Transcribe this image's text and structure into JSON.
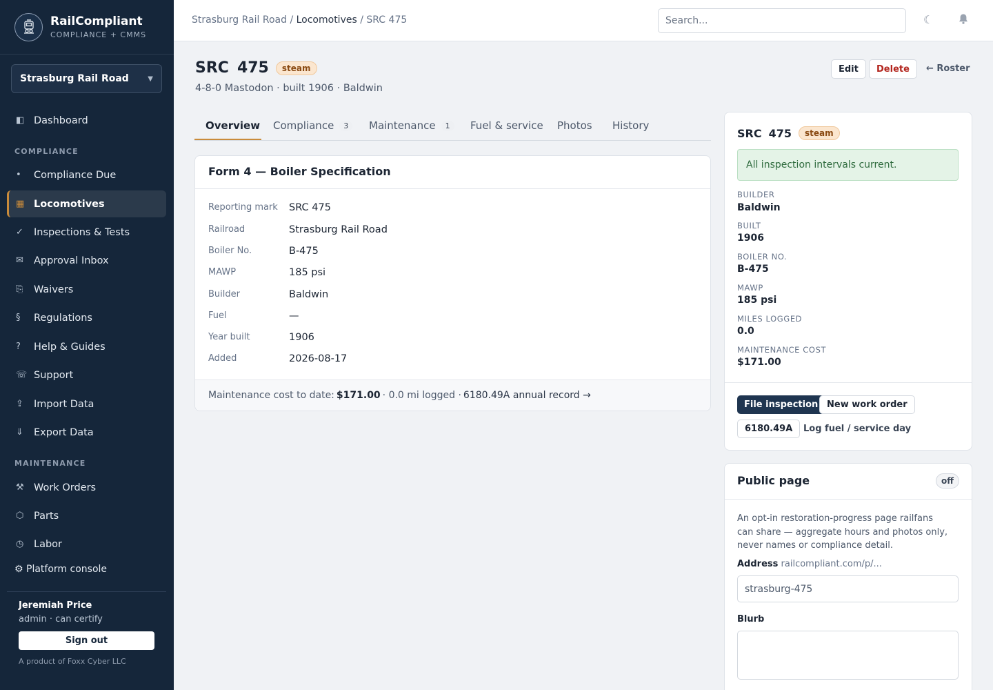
{
  "brand": {
    "name": "RailCompliant",
    "tagline": "COMPLIANCE + CMMS"
  },
  "railroad_select": {
    "value": "Strasburg Rail Road"
  },
  "nav": {
    "dashboard": "Dashboard",
    "compliance_section": "COMPLIANCE",
    "compliance_items": [
      "Compliance Due",
      "Locomotives",
      "Inspections & Tests",
      "Approval Inbox",
      "Waivers",
      "Regulations",
      "Help & Guides",
      "Support",
      "Import Data",
      "Export Data"
    ],
    "maintenance_section": "MAINTENANCE",
    "maintenance_items": [
      "Work Orders",
      "Parts",
      "Labor"
    ],
    "platform_console": "Platform console"
  },
  "user": {
    "name": "Jeremiah Price",
    "role": "admin · can certify",
    "signout_label": "Sign out",
    "product": "A product of Foxx Cyber LLC"
  },
  "topbar": {
    "breadcrumb": [
      "Strasburg Rail Road",
      "Locomotives",
      "SRC 475"
    ],
    "search_placeholder": "Search..."
  },
  "header": {
    "mark": "SRC",
    "number": "475",
    "tag": "steam",
    "subtitle": "4-8-0 Mastodon · built 1906 · Baldwin",
    "edit_label": "Edit",
    "delete_label": "Delete",
    "roster_label": "← Roster"
  },
  "tabs": [
    {
      "label": "Overview",
      "count": ""
    },
    {
      "label": "Compliance",
      "count": "3"
    },
    {
      "label": "Maintenance",
      "count": "1"
    },
    {
      "label": "Fuel & service",
      "count": ""
    },
    {
      "label": "Photos",
      "count": ""
    },
    {
      "label": "History",
      "count": ""
    }
  ],
  "form4": {
    "title": "Form 4 — Boiler Specification",
    "rows": [
      {
        "label": "Reporting mark",
        "value": "SRC 475"
      },
      {
        "label": "Railroad",
        "value": "Strasburg Rail Road"
      },
      {
        "label": "Boiler No.",
        "value": "B-475"
      },
      {
        "label": "MAWP",
        "value": "185 psi"
      },
      {
        "label": "Builder",
        "value": "Baldwin"
      },
      {
        "label": "Fuel",
        "value": "—"
      },
      {
        "label": "Year built",
        "value": "1906"
      },
      {
        "label": "Added",
        "value": "2026-08-17"
      }
    ],
    "footer": {
      "prefix": "Maintenance cost to date:",
      "cost": "$171.00",
      "middle": "· 0.0 mi logged ·",
      "link": "6180.49A annual record →"
    }
  },
  "summary": {
    "mark": "SRC",
    "number": "475",
    "tag": "steam",
    "alert": "All inspection intervals current.",
    "fields": [
      {
        "label": "BUILDER",
        "value": "Baldwin"
      },
      {
        "label": "BUILT",
        "value": "1906"
      },
      {
        "label": "BOILER NO.",
        "value": "B-475"
      },
      {
        "label": "MAWP",
        "value": "185 psi"
      },
      {
        "label": "MILES LOGGED",
        "value": "0.0"
      },
      {
        "label": "MAINTENANCE COST",
        "value": "$171.00"
      }
    ],
    "file_inspection": "File inspection",
    "new_work_order": "New work order",
    "form_6180": "6180.49A",
    "log_fuel": "Log fuel / service day"
  },
  "public_page": {
    "title": "Public page",
    "status": "off",
    "description": "An opt-in restoration-progress page railfans can share — aggregate hours and photos only, never names or compliance detail.",
    "address_label": "Address",
    "address_prefix": "railcompliant.com/p/...",
    "slug": "strasburg-475",
    "blurb_label": "Blurb"
  },
  "icons": {
    "logo": "locomotive-logo-icon",
    "theme": "moon-icon",
    "notifications": "bell-icon"
  },
  "colors": {
    "sidebar": "#15263a",
    "accent": "#c98b3b",
    "primary_button": "#1f3550",
    "delete": "#b3261e",
    "success_bg": "#e4f3e7"
  }
}
